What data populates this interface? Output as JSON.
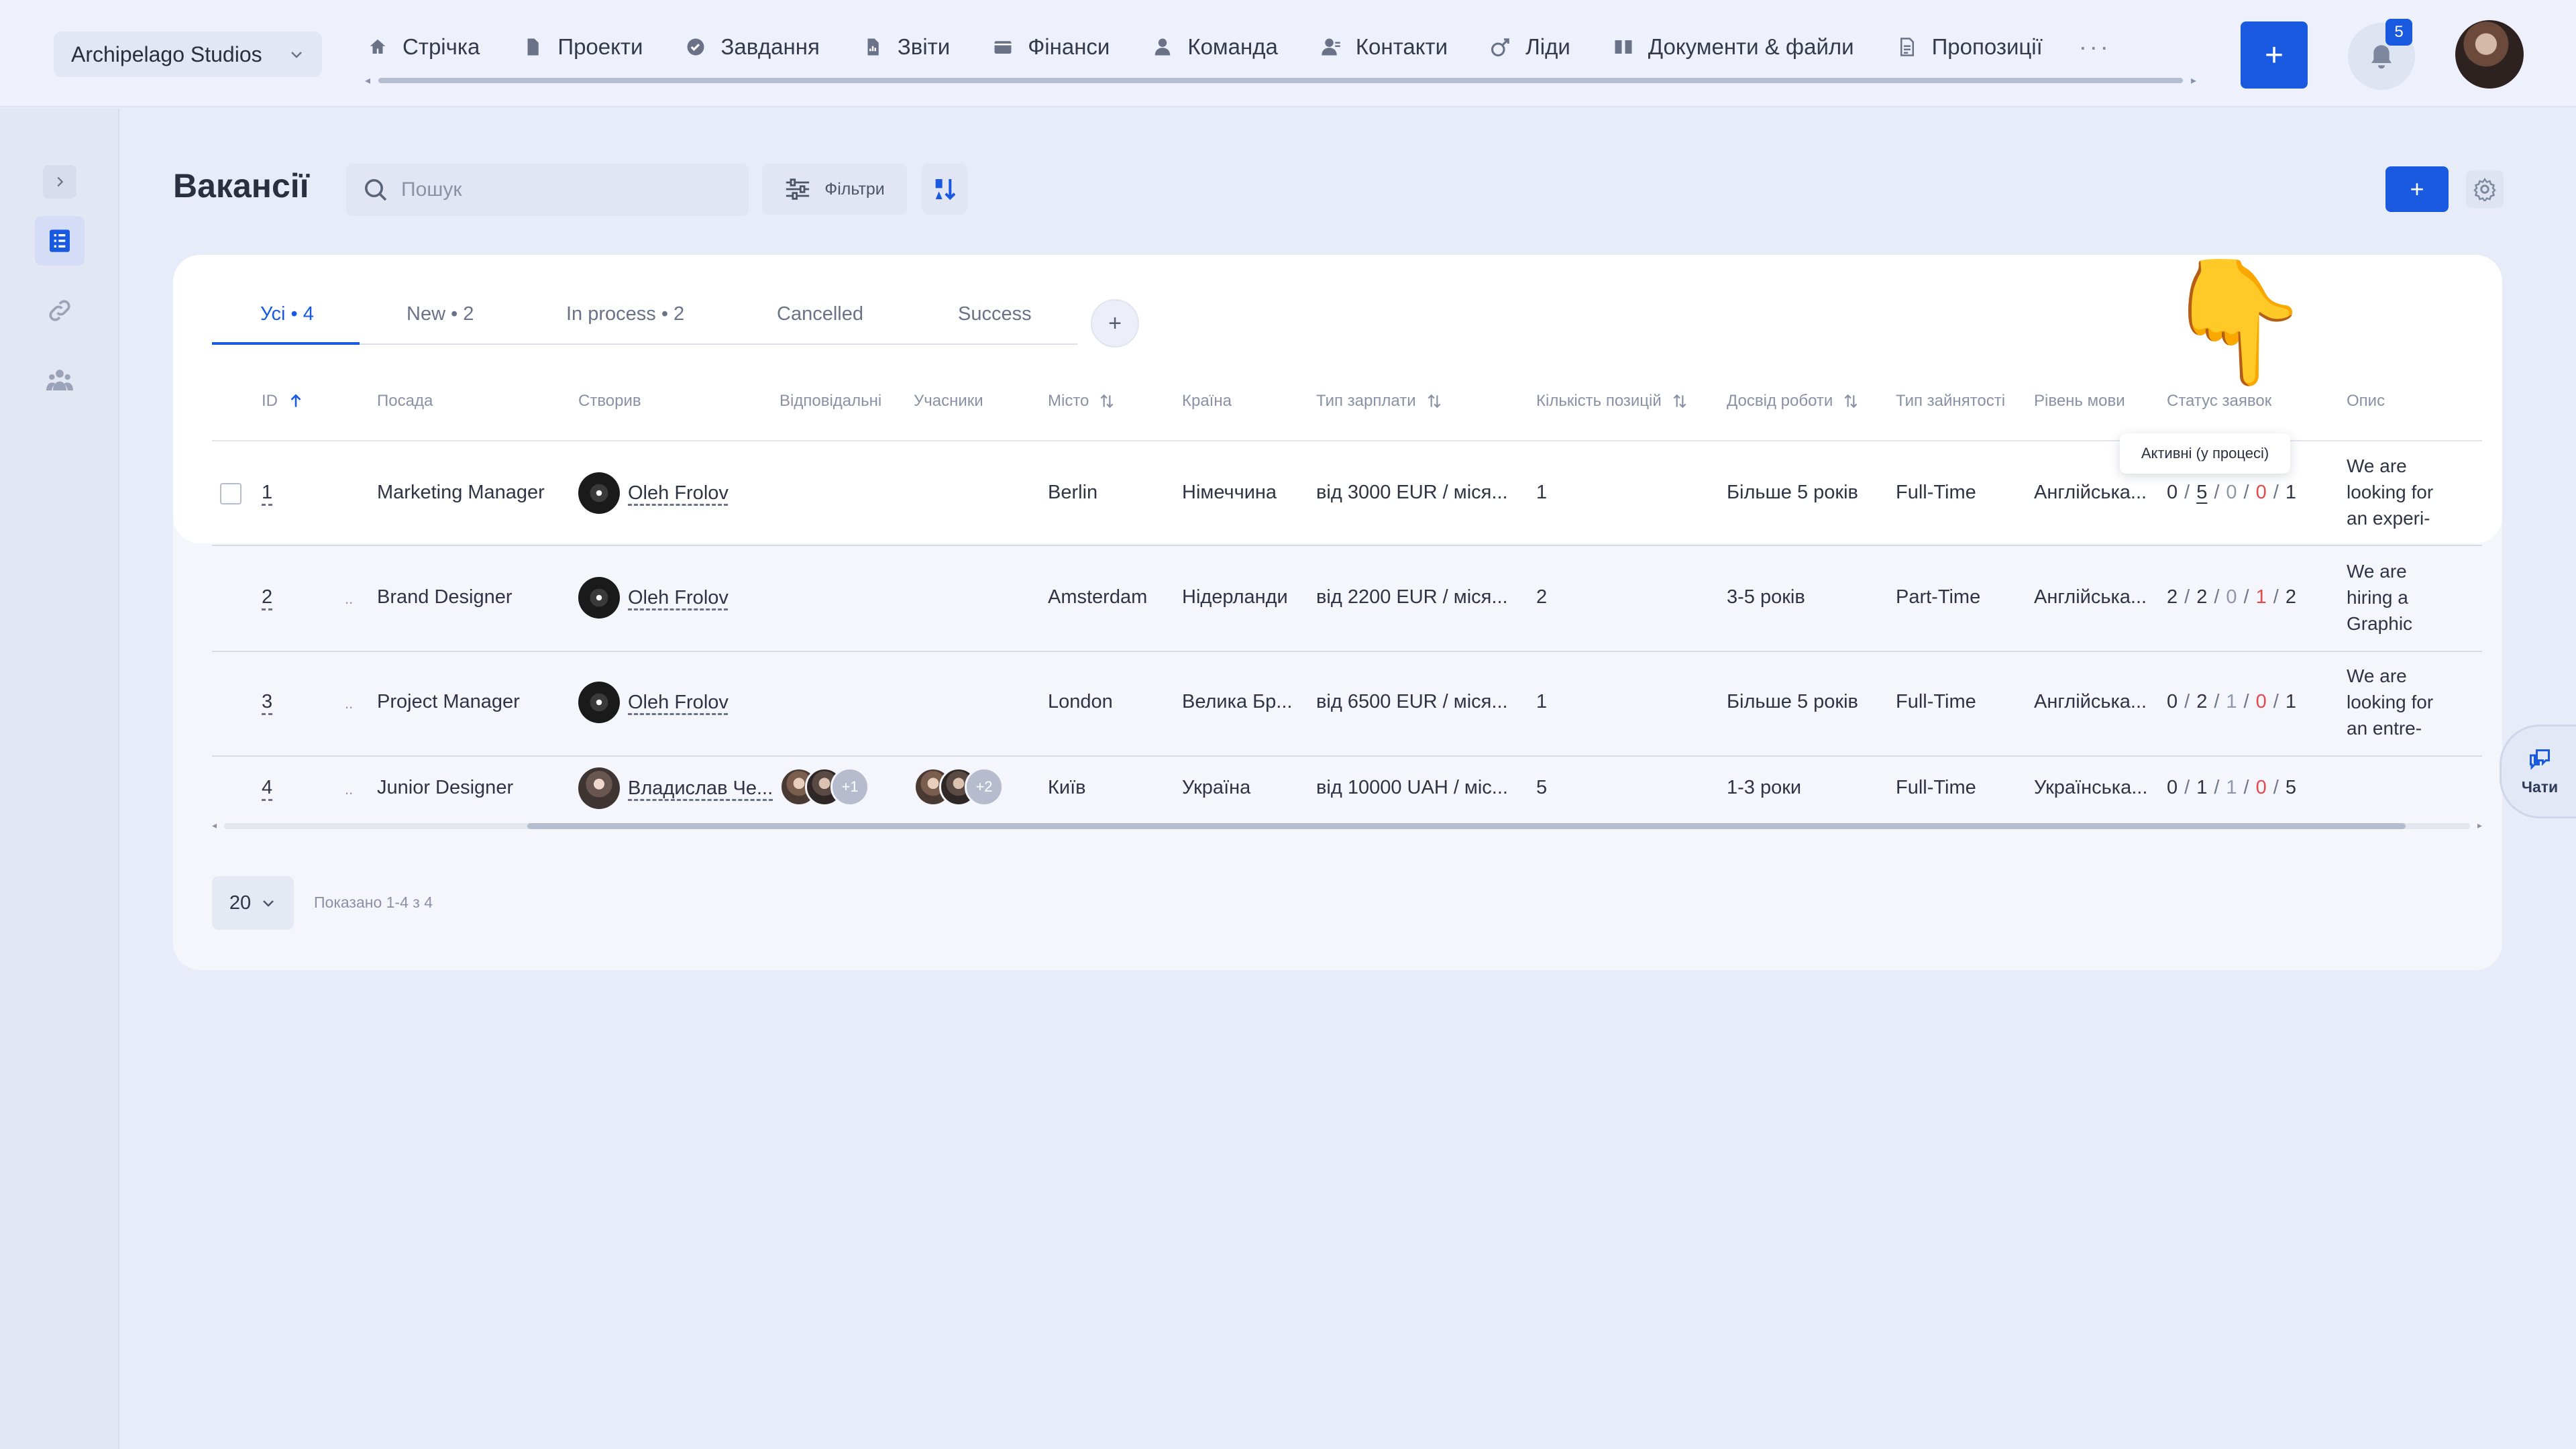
{
  "company": {
    "name": "Archipelago Studios"
  },
  "nav": {
    "items": [
      {
        "label": "Стрічка",
        "icon": "home-icon"
      },
      {
        "label": "Проекти",
        "icon": "file-icon"
      },
      {
        "label": "Завдання",
        "icon": "check-circle-icon"
      },
      {
        "label": "Звіти",
        "icon": "report-icon"
      },
      {
        "label": "Фінанси",
        "icon": "wallet-icon"
      },
      {
        "label": "Команда",
        "icon": "user-icon"
      },
      {
        "label": "Контакти",
        "icon": "contacts-icon"
      },
      {
        "label": "Ліди",
        "icon": "leads-icon"
      },
      {
        "label": "Документи & файли",
        "icon": "book-icon"
      },
      {
        "label": "Пропозиції",
        "icon": "document-icon"
      }
    ],
    "more": "···",
    "plus": "+",
    "notifications_count": "5"
  },
  "page": {
    "title": "Вакансії",
    "search_placeholder": "Пошук",
    "filters_label": "Фільтри",
    "add_label": "+"
  },
  "tabs": [
    {
      "label": "Усі • 4",
      "active": true
    },
    {
      "label": "New • 2"
    },
    {
      "label": "In process • 2"
    },
    {
      "label": "Cancelled"
    },
    {
      "label": "Success"
    }
  ],
  "tab_add": "+",
  "columns": {
    "id": "ID",
    "position": "Посада",
    "created_by": "Створив",
    "responsible": "Відповідальні",
    "participants": "Учасники",
    "city": "Місто",
    "country": "Країна",
    "salary_type": "Тип зарплати",
    "positions_count": "Кількість позицій",
    "experience": "Досвід роботи",
    "employment_type": "Тип зайнятості",
    "language_level": "Рівень мови",
    "applications_status": "Статус заявок",
    "description": "Опис"
  },
  "rows": [
    {
      "id": "1",
      "position": "Marketing Manager",
      "created_by": "Oleh Frolov",
      "city": "Berlin",
      "country": "Німеччина",
      "salary": "від 3000 EUR / міся...",
      "count": "1",
      "experience": "Більше 5 років",
      "employment": "Full-Time",
      "language": "Англійська...",
      "status": [
        "0",
        "5",
        "0",
        "0",
        "1"
      ],
      "desc_lines": [
        "We are",
        "looking for",
        "an experi-"
      ]
    },
    {
      "id": "2",
      "position": "Brand Designer",
      "created_by": "Oleh Frolov",
      "city": "Amsterdam",
      "country": "Нідерланди",
      "salary": "від 2200 EUR / міся...",
      "count": "2",
      "experience": "3-5 років",
      "employment": "Part-Time",
      "language": "Англійська...",
      "status": [
        "2",
        "2",
        "0",
        "1",
        "2"
      ],
      "desc_lines": [
        "We are",
        "hiring a",
        "Graphic"
      ]
    },
    {
      "id": "3",
      "position": "Project Manager",
      "created_by": "Oleh Frolov",
      "city": "London",
      "country": "Велика Бр...",
      "salary": "від 6500 EUR / міся...",
      "count": "1",
      "experience": "Більше 5 років",
      "employment": "Full-Time",
      "language": "Англійська...",
      "status": [
        "0",
        "2",
        "1",
        "0",
        "1"
      ],
      "desc_lines": [
        "We are",
        "looking for",
        "an entre-"
      ]
    },
    {
      "id": "4",
      "position": "Junior Designer",
      "created_by": "Владислав Че...",
      "responsible_more": "+1",
      "participants_more": "+2",
      "city": "Київ",
      "country": "Україна",
      "salary": "від 10000 UAH / міс...",
      "count": "5",
      "experience": "1-3 роки",
      "employment": "Full-Time",
      "language": "Українська...",
      "status": [
        "0",
        "1",
        "1",
        "0",
        "5"
      ],
      "desc_lines": []
    }
  ],
  "row_dash": "..",
  "tooltip": "Активні (у процесі)",
  "pagination": {
    "page_size": "20",
    "shown": "Показано 1-4 з 4"
  },
  "chat": {
    "label": "Чати"
  },
  "pointer_emoji": "👇",
  "colors": {
    "accent": "#1a5ae0",
    "status_red": "#e5484d",
    "status_gray": "#8f96a9"
  }
}
